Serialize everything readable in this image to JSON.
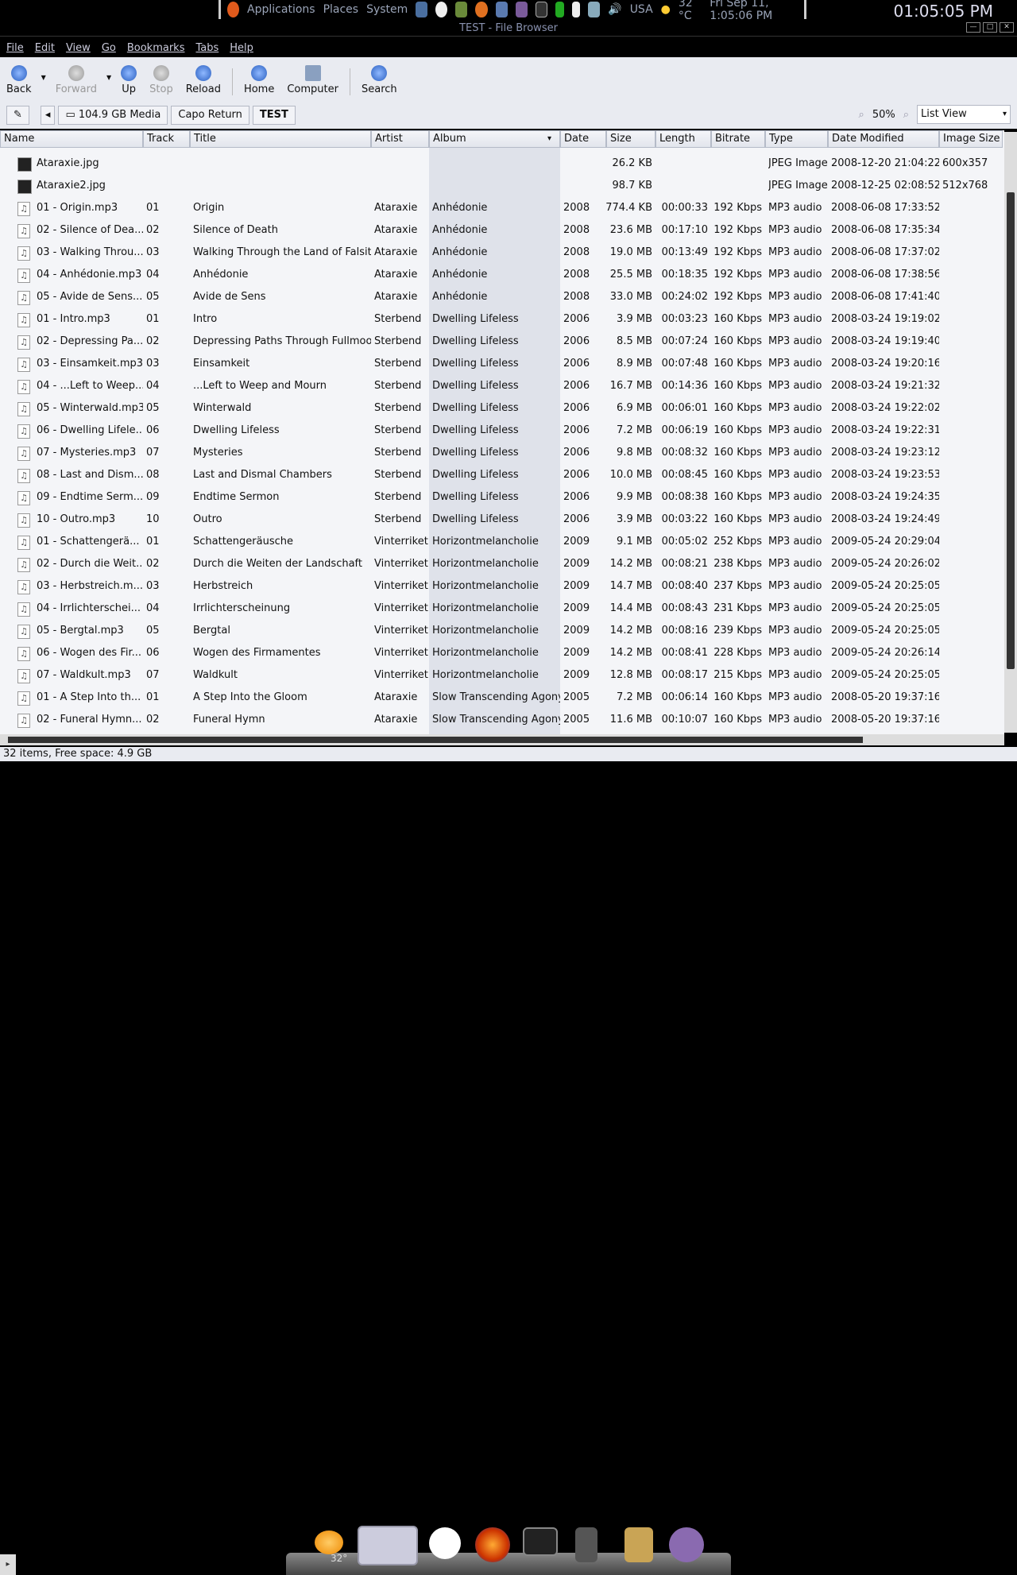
{
  "top_panel": {
    "menus": [
      "Applications",
      "Places",
      "System"
    ],
    "locale": "USA",
    "weather": "32 °C",
    "datetime": "Fri Sep 11,  1:05:06 PM"
  },
  "clock": "01:05:05 PM",
  "window": {
    "title": "TEST - File Browser"
  },
  "menubar": [
    "File",
    "Edit",
    "View",
    "Go",
    "Bookmarks",
    "Tabs",
    "Help"
  ],
  "toolbar": {
    "back": "Back",
    "forward": "Forward",
    "up": "Up",
    "stop": "Stop",
    "reload": "Reload",
    "home": "Home",
    "computer": "Computer",
    "search": "Search"
  },
  "location": {
    "crumbs": [
      "104.9 GB Media",
      "Capo Return",
      "TEST"
    ],
    "zoom": "50%",
    "view": "List View"
  },
  "columns": [
    "Name",
    "Track",
    "Title",
    "Artist",
    "Album",
    "Date",
    "Size",
    "Length",
    "Bitrate",
    "Type",
    "Date Modified",
    "Image Size"
  ],
  "rows": [
    [
      "Ataraxie.jpg",
      "",
      "",
      "",
      "",
      "",
      "26.2 KB",
      "",
      "",
      "JPEG Image",
      "2008-12-20 21:04:22",
      "600x357"
    ],
    [
      "Ataraxie2.jpg",
      "",
      "",
      "",
      "",
      "",
      "98.7 KB",
      "",
      "",
      "JPEG Image",
      "2008-12-25 02:08:52",
      "512x768"
    ],
    [
      "01 - Origin.mp3",
      "01",
      "Origin",
      "Ataraxie",
      "Anhédonie",
      "2008",
      "774.4 KB",
      "00:00:33",
      "192 Kbps",
      "MP3 audio",
      "2008-06-08 17:33:52",
      ""
    ],
    [
      "02 - Silence of Dea...",
      "02",
      "Silence of Death",
      "Ataraxie",
      "Anhédonie",
      "2008",
      "23.6 MB",
      "00:17:10",
      "192 Kbps",
      "MP3 audio",
      "2008-06-08 17:35:34",
      ""
    ],
    [
      "03 - Walking Throu...",
      "03",
      "Walking Through the Land of Falsity",
      "Ataraxie",
      "Anhédonie",
      "2008",
      "19.0 MB",
      "00:13:49",
      "192 Kbps",
      "MP3 audio",
      "2008-06-08 17:37:02",
      ""
    ],
    [
      "04 - Anhédonie.mp3",
      "04",
      "Anhédonie",
      "Ataraxie",
      "Anhédonie",
      "2008",
      "25.5 MB",
      "00:18:35",
      "192 Kbps",
      "MP3 audio",
      "2008-06-08 17:38:56",
      ""
    ],
    [
      "05 - Avide de Sens...",
      "05",
      "Avide de Sens",
      "Ataraxie",
      "Anhédonie",
      "2008",
      "33.0 MB",
      "00:24:02",
      "192 Kbps",
      "MP3 audio",
      "2008-06-08 17:41:40",
      ""
    ],
    [
      "01 - Intro.mp3",
      "01",
      "Intro",
      "Sterbend",
      "Dwelling Lifeless",
      "2006",
      "3.9 MB",
      "00:03:23",
      "160 Kbps",
      "MP3 audio",
      "2008-03-24 19:19:02",
      ""
    ],
    [
      "02 - Depressing Pa...",
      "02",
      "Depressing Paths Through Fullmoon",
      "Sterbend",
      "Dwelling Lifeless",
      "2006",
      "8.5 MB",
      "00:07:24",
      "160 Kbps",
      "MP3 audio",
      "2008-03-24 19:19:40",
      ""
    ],
    [
      "03 - Einsamkeit.mp3",
      "03",
      "Einsamkeit",
      "Sterbend",
      "Dwelling Lifeless",
      "2006",
      "8.9 MB",
      "00:07:48",
      "160 Kbps",
      "MP3 audio",
      "2008-03-24 19:20:16",
      ""
    ],
    [
      "04 - ...Left to Weep...",
      "04",
      "...Left to Weep and Mourn",
      "Sterbend",
      "Dwelling Lifeless",
      "2006",
      "16.7 MB",
      "00:14:36",
      "160 Kbps",
      "MP3 audio",
      "2008-03-24 19:21:32",
      ""
    ],
    [
      "05 - Winterwald.mp3",
      "05",
      "Winterwald",
      "Sterbend",
      "Dwelling Lifeless",
      "2006",
      "6.9 MB",
      "00:06:01",
      "160 Kbps",
      "MP3 audio",
      "2008-03-24 19:22:02",
      ""
    ],
    [
      "06 - Dwelling Lifele...",
      "06",
      "Dwelling Lifeless",
      "Sterbend",
      "Dwelling Lifeless",
      "2006",
      "7.2 MB",
      "00:06:19",
      "160 Kbps",
      "MP3 audio",
      "2008-03-24 19:22:31",
      ""
    ],
    [
      "07 - Mysteries.mp3",
      "07",
      "Mysteries",
      "Sterbend",
      "Dwelling Lifeless",
      "2006",
      "9.8 MB",
      "00:08:32",
      "160 Kbps",
      "MP3 audio",
      "2008-03-24 19:23:12",
      ""
    ],
    [
      "08 - Last and Dism...",
      "08",
      "Last and Dismal Chambers",
      "Sterbend",
      "Dwelling Lifeless",
      "2006",
      "10.0 MB",
      "00:08:45",
      "160 Kbps",
      "MP3 audio",
      "2008-03-24 19:23:53",
      ""
    ],
    [
      "09 - Endtime Serm...",
      "09",
      "Endtime Sermon",
      "Sterbend",
      "Dwelling Lifeless",
      "2006",
      "9.9 MB",
      "00:08:38",
      "160 Kbps",
      "MP3 audio",
      "2008-03-24 19:24:35",
      ""
    ],
    [
      "10 - Outro.mp3",
      "10",
      "Outro",
      "Sterbend",
      "Dwelling Lifeless",
      "2006",
      "3.9 MB",
      "00:03:22",
      "160 Kbps",
      "MP3 audio",
      "2008-03-24 19:24:49",
      ""
    ],
    [
      "01 - Schattengerä...",
      "01",
      "Schattengeräusche",
      "Vinterriket",
      "Horizontmelancholie",
      "2009",
      "9.1 MB",
      "00:05:02",
      "252 Kbps",
      "MP3 audio",
      "2009-05-24 20:29:04",
      ""
    ],
    [
      "02 - Durch die Weit...",
      "02",
      "Durch die Weiten der Landschaft",
      "Vinterriket",
      "Horizontmelancholie",
      "2009",
      "14.2 MB",
      "00:08:21",
      "238 Kbps",
      "MP3 audio",
      "2009-05-24 20:26:02",
      ""
    ],
    [
      "03 - Herbstreich.m...",
      "03",
      "Herbstreich",
      "Vinterriket",
      "Horizontmelancholie",
      "2009",
      "14.7 MB",
      "00:08:40",
      "237 Kbps",
      "MP3 audio",
      "2009-05-24 20:25:05",
      ""
    ],
    [
      "04 - Irrlichterschei...",
      "04",
      "Irrlichterscheinung",
      "Vinterriket",
      "Horizontmelancholie",
      "2009",
      "14.4 MB",
      "00:08:43",
      "231 Kbps",
      "MP3 audio",
      "2009-05-24 20:25:05",
      ""
    ],
    [
      "05 - Bergtal.mp3",
      "05",
      "Bergtal",
      "Vinterriket",
      "Horizontmelancholie",
      "2009",
      "14.2 MB",
      "00:08:16",
      "239 Kbps",
      "MP3 audio",
      "2009-05-24 20:25:05",
      ""
    ],
    [
      "06 - Wogen des Fir...",
      "06",
      "Wogen des Firmamentes",
      "Vinterriket",
      "Horizontmelancholie",
      "2009",
      "14.2 MB",
      "00:08:41",
      "228 Kbps",
      "MP3 audio",
      "2009-05-24 20:26:14",
      ""
    ],
    [
      "07 - Waldkult.mp3",
      "07",
      "Waldkult",
      "Vinterriket",
      "Horizontmelancholie",
      "2009",
      "12.8 MB",
      "00:08:17",
      "215 Kbps",
      "MP3 audio",
      "2009-05-24 20:25:05",
      ""
    ],
    [
      "01 - A Step Into th...",
      "01",
      "A Step Into the Gloom",
      "Ataraxie",
      "Slow Transcending Agony",
      "2005",
      "7.2 MB",
      "00:06:14",
      "160 Kbps",
      "MP3 audio",
      "2008-05-20 19:37:16",
      ""
    ],
    [
      "02 - Funeral Hymn....",
      "02",
      "Funeral Hymn",
      "Ataraxie",
      "Slow Transcending Agony",
      "2005",
      "11.6 MB",
      "00:10:07",
      "160 Kbps",
      "MP3 audio",
      "2008-05-20 19:37:16",
      ""
    ]
  ],
  "status": "32 items, Free space: 4.9 GB",
  "dock": {
    "weather_temp": "32°"
  }
}
